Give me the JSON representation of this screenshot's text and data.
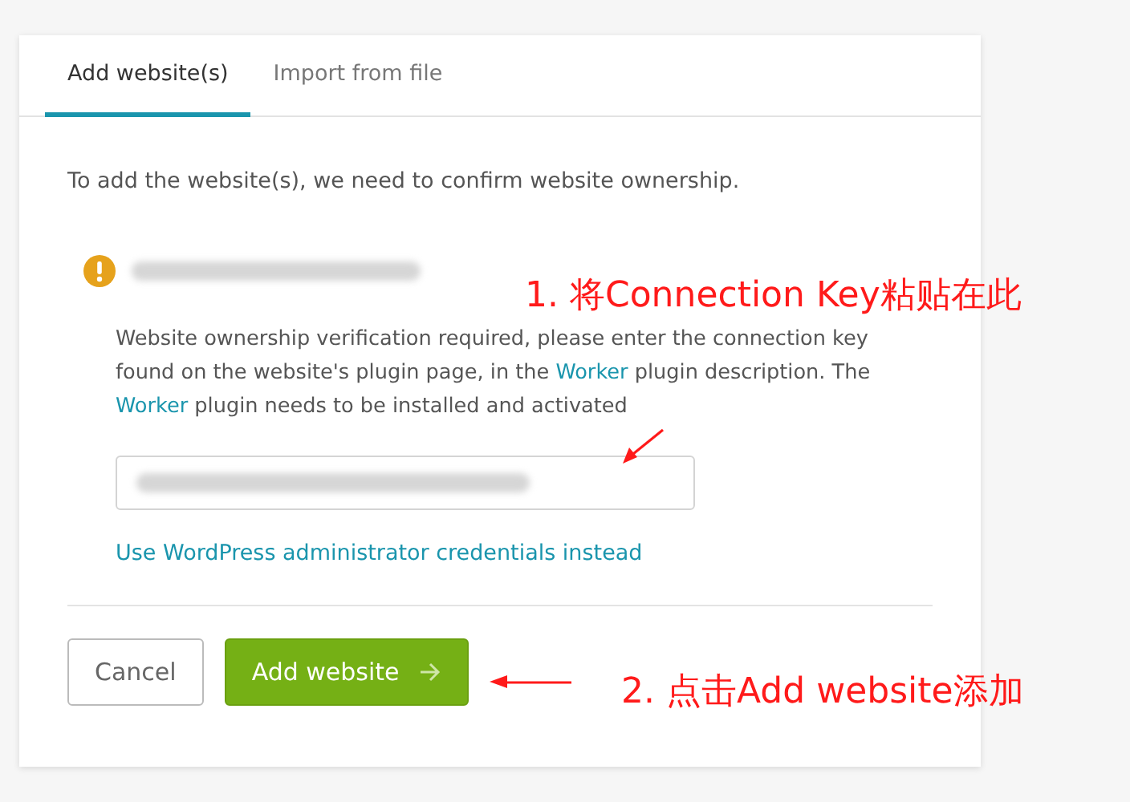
{
  "tabs": [
    {
      "label": "Add website(s)",
      "selected": true
    },
    {
      "label": "Import from file",
      "selected": false
    }
  ],
  "intro": "To add the website(s), we need to confirm website ownership.",
  "verification": {
    "segments": [
      {
        "kind": "text",
        "text": "Website ownership verification required, please enter the connection key found on the website's plugin page, in the "
      },
      {
        "kind": "link",
        "text": "Worker"
      },
      {
        "kind": "text",
        "text": " plugin description. The "
      },
      {
        "kind": "link",
        "text": "Worker"
      },
      {
        "kind": "text",
        "text": " plugin needs to be installed and activated"
      }
    ]
  },
  "alt_link": "Use WordPress administrator credentials instead",
  "buttons": [
    {
      "kind": "secondary",
      "label": "Cancel"
    },
    {
      "kind": "primary",
      "label": "Add website"
    }
  ],
  "annotations": [
    {
      "text": "1. 将Connection Key粘贴在此"
    },
    {
      "text": "2. 点击Add website添加"
    }
  ]
}
